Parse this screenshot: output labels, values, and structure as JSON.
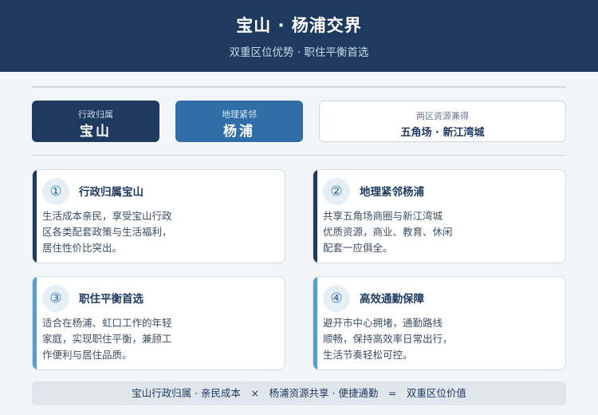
{
  "header": {
    "title": "宝山 · 杨浦交界",
    "subtitle": "双重区位优势 · 职住平衡首选"
  },
  "pills": [
    {
      "small": "行政归属",
      "big": "宝山"
    },
    {
      "small": "地理紧邻",
      "big": "杨浦"
    },
    {
      "small": "两区资源兼得",
      "big": "五角场 · 新江湾城"
    }
  ],
  "cards": [
    {
      "num": "①",
      "title": "行政归属宝山",
      "lines": [
        "生活成本亲民，享受宝山行政",
        "区各类配套政策与生活福利，",
        "居住性价比突出。"
      ]
    },
    {
      "num": "②",
      "title": "地理紧邻杨浦",
      "lines": [
        "共享五角场商圈与新江湾城",
        "优质资源，商业、教育、休闲",
        "配套一应俱全。"
      ]
    },
    {
      "num": "③",
      "title": "职住平衡首选",
      "lines": [
        "适合在杨浦、虹口工作的年轻",
        "家庭，实现职住平衡，兼顾工",
        "作便利与居住品质。"
      ]
    },
    {
      "num": "④",
      "title": "高效通勤保障",
      "lines": [
        "避开市中心拥堵，通勤路线",
        "顺畅，保持高效率日常出行，",
        "生活节奏轻松可控。"
      ]
    }
  ],
  "colors": {
    "navy": "#1e3a5f",
    "blue": "#2f6ea6",
    "accent_light": "#4aa3d8"
  },
  "footer": {
    "text": "宝山行政归属 · 亲民成本　×　杨浦资源共享 · 便捷通勤　=　双重区位价值"
  }
}
